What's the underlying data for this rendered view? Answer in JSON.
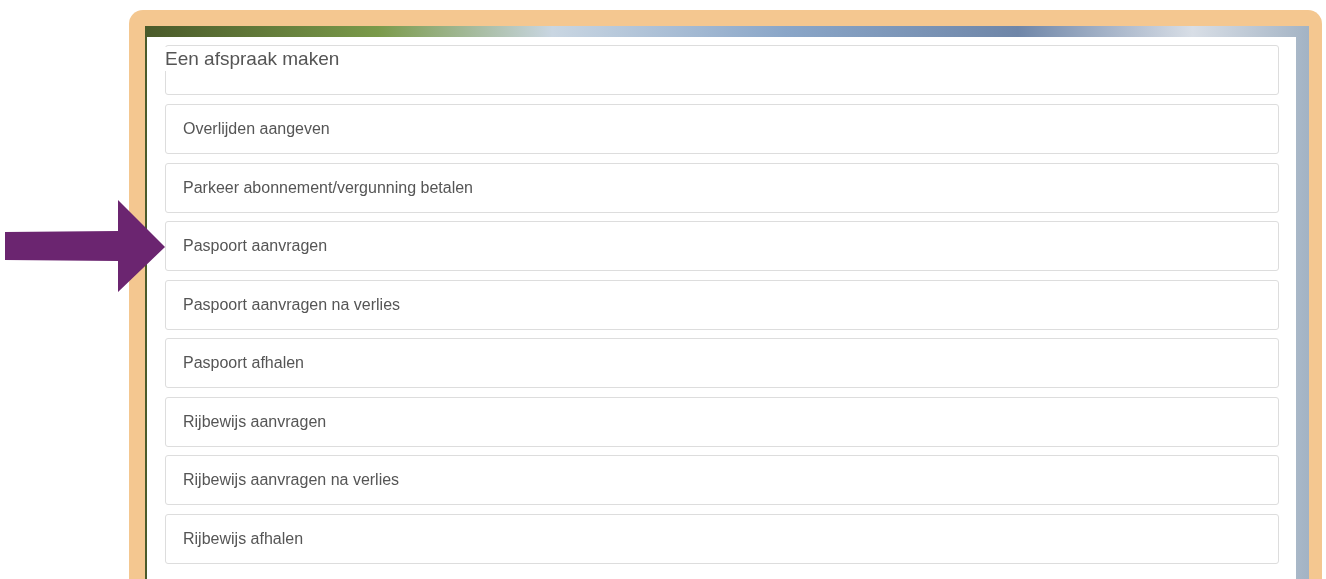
{
  "dialog": {
    "title": "Een afspraak maken"
  },
  "items": [
    {
      "label": "Overlijden aangeven"
    },
    {
      "label": "Parkeer abonnement/vergunning betalen"
    },
    {
      "label": "Paspoort aanvragen"
    },
    {
      "label": "Paspoort aanvragen na verlies"
    },
    {
      "label": "Paspoort afhalen"
    },
    {
      "label": "Rijbewijs aanvragen"
    },
    {
      "label": "Rijbewijs aanvragen na verlies"
    },
    {
      "label": "Rijbewijs afhalen"
    }
  ]
}
